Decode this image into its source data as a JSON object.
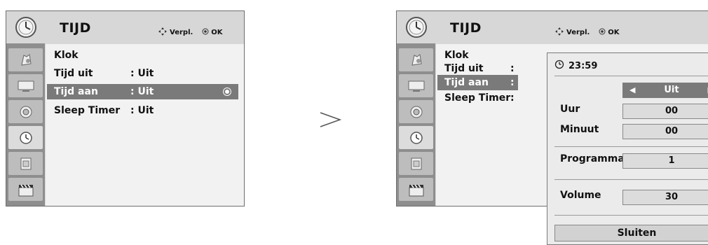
{
  "left_panel": {
    "title": "TIJD",
    "hint_move": "Verpl.",
    "hint_ok": "OK",
    "sidebar_icons": [
      "picture-icon",
      "monitor-icon",
      "speaker-icon",
      "clock-icon",
      "film-icon",
      "clapper-icon"
    ],
    "menu": [
      {
        "label": "Klok",
        "value": ""
      },
      {
        "label": "Tijd uit",
        "value": ": Uit"
      },
      {
        "label": "Tijd aan",
        "value": ": Uit"
      },
      {
        "label": "Sleep Timer",
        "value": ": Uit"
      }
    ],
    "selected_index": 2
  },
  "right_panel": {
    "title": "TIJD",
    "hint_move": "Verpl.",
    "hint_ok": "OK",
    "menu": [
      {
        "label": "Klok",
        "value": ""
      },
      {
        "label": "Tijd uit",
        "value": ":"
      },
      {
        "label": "Tijd aan",
        "value": ":"
      },
      {
        "label": "Sleep Timer",
        "value": ":"
      }
    ],
    "selected_index": 2
  },
  "popup": {
    "time": "23:59",
    "toggle_value": "Uit",
    "fields": {
      "hour_label": "Uur",
      "hour_value": "00",
      "minute_label": "Minuut",
      "minute_value": "00",
      "program_label": "Programma",
      "program_value": "1",
      "volume_label": "Volume",
      "volume_value": "30"
    },
    "close_label": "Sluiten"
  },
  "colors": {
    "selection": "#7a7a7a",
    "sidebar": "#8e8e8e",
    "panel": "#d7d7d7"
  }
}
